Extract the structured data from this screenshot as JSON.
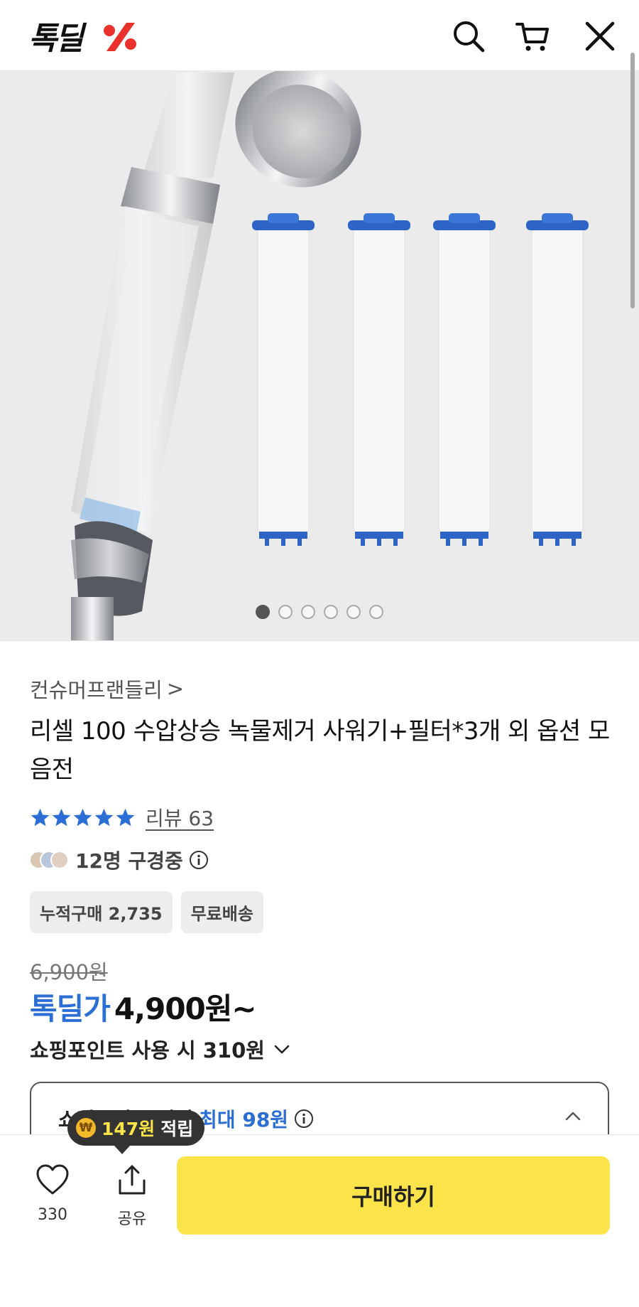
{
  "header": {
    "logo_text": "톡딜",
    "logo_mark": "%",
    "icons": [
      "search-icon",
      "cart-icon",
      "close-icon"
    ]
  },
  "gallery": {
    "total_slides": 6,
    "active_slide": 1
  },
  "product": {
    "brand": "컨슈머프랜들리",
    "brand_chevron": ">",
    "title": "리셀 100 수압상승 녹물제거 사워기+필터*3개 외 옵션 모음전",
    "rating_stars": 5,
    "review_label": "리뷰 63",
    "viewers_text": "12명 구경중",
    "tags": [
      "누적구매 2,735",
      "무료배송"
    ],
    "original_price": "6,900원",
    "deal_label": "톡딜가",
    "deal_price": "4,900원~",
    "points_text": "쇼핑포인트 사용 시 310원"
  },
  "accordion": {
    "label": "쇼핑포인트 적립",
    "highlight": "최대 98원"
  },
  "tooltip": {
    "coin": "₩",
    "amount": "147원",
    "suffix": "적립"
  },
  "bottom_bar": {
    "like_count": "330",
    "share_label": "공유",
    "buy_label": "구매하기"
  },
  "colors": {
    "accent_blue": "#2c6fd4",
    "buy_yellow": "#fae44a",
    "logo_red": "#e8322b"
  }
}
